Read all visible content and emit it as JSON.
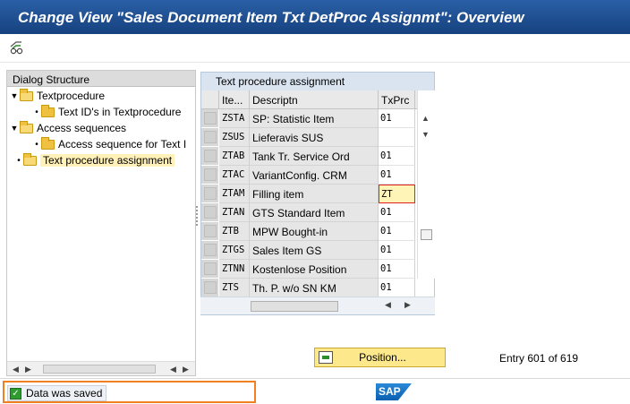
{
  "window": {
    "title": "Change View \"Sales Document Item Txt DetProc Assignmt\": Overview"
  },
  "toolbar": {
    "buttons": [
      {
        "icon": "glasses-icon"
      }
    ]
  },
  "dialog_structure": {
    "header": "Dialog Structure",
    "items": [
      {
        "label": "Textprocedure",
        "level": 0,
        "expanded": true
      },
      {
        "label": "Text ID's in Textprocedure",
        "level": 1
      },
      {
        "label": "Access sequences",
        "level": 0,
        "expanded": true
      },
      {
        "label": "Access sequence for Text I",
        "level": 1
      },
      {
        "label": "Text procedure assignment",
        "level": 0,
        "selected": true
      }
    ]
  },
  "table": {
    "caption": "Text procedure assignment",
    "columns": [
      "Ite...",
      "Descriptn",
      "TxPrc"
    ],
    "rows": [
      {
        "item": "ZSTA",
        "desc": "SP: Statistic Item",
        "txprc": "01"
      },
      {
        "item": "ZSUS",
        "desc": "Lieferavis SUS",
        "txprc": ""
      },
      {
        "item": "ZTAB",
        "desc": "Tank Tr. Service Ord",
        "txprc": "01"
      },
      {
        "item": "ZTAC",
        "desc": "VariantConfig. CRM",
        "txprc": "01"
      },
      {
        "item": "ZTAM",
        "desc": "Filling item",
        "txprc": "ZT",
        "focused": true
      },
      {
        "item": "ZTAN",
        "desc": "GTS Standard Item",
        "txprc": "01"
      },
      {
        "item": "ZTB",
        "desc": "MPW Bought-in",
        "txprc": "01"
      },
      {
        "item": "ZTGS",
        "desc": "Sales Item GS",
        "txprc": "01"
      },
      {
        "item": "ZTNN",
        "desc": "Kostenlose Position",
        "txprc": "01"
      },
      {
        "item": "ZTS",
        "desc": "Th. P. w/o SN KM",
        "txprc": "01"
      }
    ]
  },
  "actions": {
    "position_label": "Position..."
  },
  "entry_info": "Entry 601 of 619",
  "status": {
    "message": "Data was saved",
    "type": "success"
  },
  "branding": {
    "logo": "SAP"
  },
  "colors": {
    "title_bar": "#1f4e8c",
    "status_highlight": "#f08020",
    "focus_border": "#e02020",
    "position_button": "#fde98c"
  }
}
